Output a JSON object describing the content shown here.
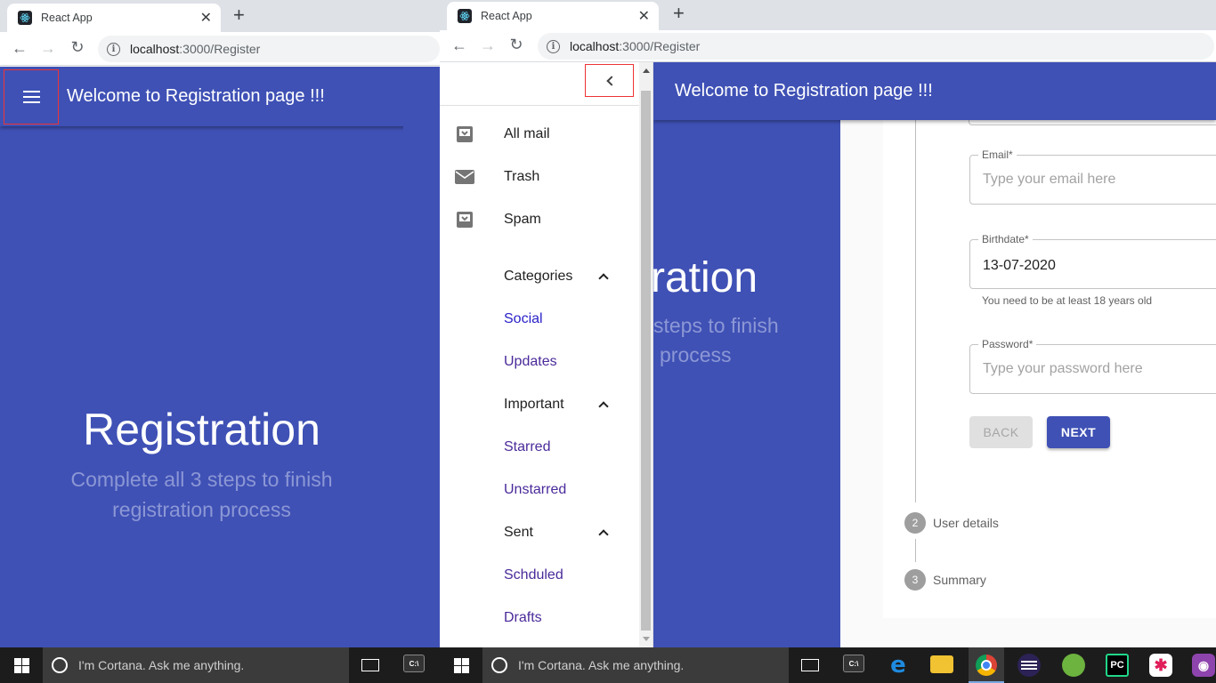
{
  "left_window": {
    "tab_title": "React App",
    "url_host": "localhost",
    "url_path": ":3000/Register",
    "appbar_title": "Welcome to Registration page !!!",
    "hero_title": "Registration",
    "hero_subtitle_line1": "Complete all 3 steps to finish",
    "hero_subtitle_line2": "registration process"
  },
  "right_window": {
    "tab_title": "React App",
    "url_host": "localhost",
    "url_path": ":3000/Register",
    "appbar_title": "Welcome to Registration page !!!",
    "hero_title_partial": "ration",
    "hero_subtitle_partial1": "steps to finish",
    "hero_subtitle_partial2": "process"
  },
  "drawer": {
    "items": [
      {
        "label": "All mail",
        "icon": "inbox-icon"
      },
      {
        "label": "Trash",
        "icon": "mail-icon"
      },
      {
        "label": "Spam",
        "icon": "inbox-icon"
      }
    ],
    "groups": [
      {
        "label": "Categories",
        "children": [
          "Social",
          "Updates"
        ]
      },
      {
        "label": "Important",
        "children": [
          "Starred",
          "Unstarred"
        ]
      },
      {
        "label": "Sent",
        "children": [
          "Schduled",
          "Drafts"
        ]
      }
    ]
  },
  "form": {
    "email": {
      "label": "Email",
      "required": "*",
      "placeholder": "Type your email here"
    },
    "birthdate": {
      "label": "Birthdate",
      "required": "*",
      "value": "13-07-2020",
      "helper": "You need to be at least 18 years old"
    },
    "password": {
      "label": "Password",
      "required": "*",
      "placeholder": "Type your password here"
    },
    "back_label": "BACK",
    "next_label": "NEXT",
    "steps": [
      {
        "number": "2",
        "label": "User details"
      },
      {
        "number": "3",
        "label": "Summary"
      }
    ]
  },
  "taskbar": {
    "cortana_text": "I'm Cortana. Ask me anything."
  },
  "colors": {
    "primary": "#3f51b5",
    "hero_subtitle": "#8c97d5",
    "drawer_link": "#4a2a9a",
    "taskbar": "#1c1c1c"
  }
}
